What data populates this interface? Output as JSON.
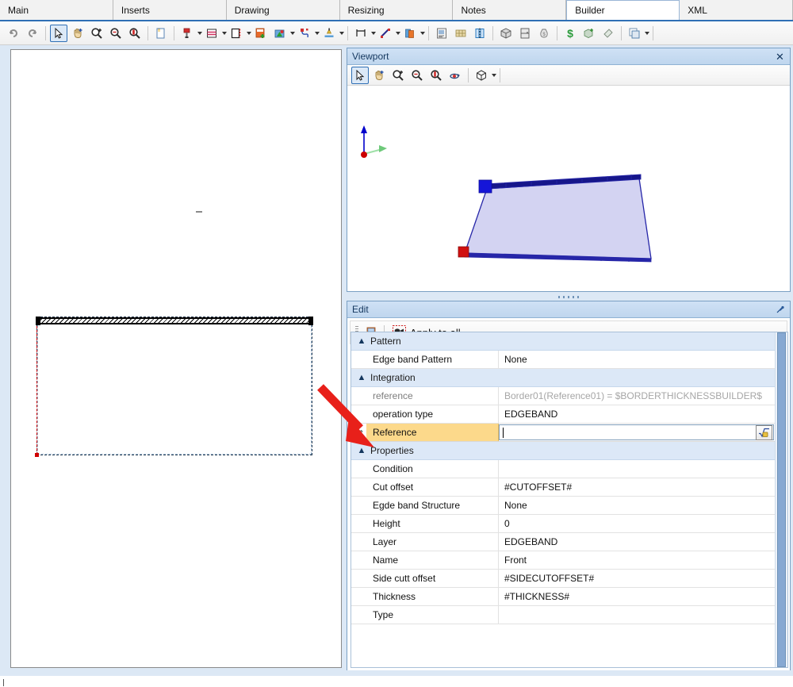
{
  "tabs": [
    {
      "label": "Main",
      "active": false
    },
    {
      "label": "Inserts",
      "active": false
    },
    {
      "label": "Drawing",
      "active": false
    },
    {
      "label": "Resizing",
      "active": false
    },
    {
      "label": "Notes",
      "active": false
    },
    {
      "label": "Builder",
      "active": true
    },
    {
      "label": "XML",
      "active": false
    }
  ],
  "toolbar": {
    "items": [
      {
        "name": "undo-icon",
        "glyph": "↶"
      },
      {
        "name": "redo-icon",
        "glyph": "↷"
      },
      {
        "name": "select-arrow-icon",
        "glyph": "➤"
      },
      {
        "name": "pan-hand-icon",
        "glyph": "✋"
      },
      {
        "name": "zoom-in-icon",
        "glyph": "🔍"
      },
      {
        "name": "zoom-out-icon",
        "glyph": "🔍"
      },
      {
        "name": "zoom-window-icon",
        "glyph": "🔍"
      },
      {
        "name": "new-panel-icon",
        "glyph": "□"
      },
      {
        "name": "drill-icon",
        "glyph": "⚒"
      },
      {
        "name": "groove-icon",
        "glyph": "☰"
      },
      {
        "name": "edgeband-icon",
        "glyph": "▯"
      },
      {
        "name": "insert-machining-icon",
        "glyph": "⊞"
      },
      {
        "name": "pocket-icon",
        "glyph": "▲"
      },
      {
        "name": "contour-icon",
        "glyph": "∿"
      },
      {
        "name": "bevel-icon",
        "glyph": "▃"
      },
      {
        "name": "dimension-icon",
        "glyph": "┐"
      },
      {
        "name": "line-icon",
        "glyph": "╱"
      },
      {
        "name": "material-icon",
        "glyph": "▣"
      },
      {
        "name": "properties-icon",
        "glyph": "▤"
      },
      {
        "name": "library-icon",
        "glyph": "▦"
      },
      {
        "name": "panel-view-icon",
        "glyph": "▮"
      },
      {
        "name": "box-3d-icon",
        "glyph": "⬛"
      },
      {
        "name": "cabinet-icon",
        "glyph": "▭"
      },
      {
        "name": "cost-bag-icon",
        "glyph": "💰"
      },
      {
        "name": "price-icon",
        "glyph": "$"
      },
      {
        "name": "export-icon",
        "glyph": "⬚"
      },
      {
        "name": "tag-icon",
        "glyph": "◇"
      },
      {
        "name": "layers-icon",
        "glyph": "❐"
      }
    ]
  },
  "viewport": {
    "title": "Viewport",
    "close_label": "✕",
    "toolbar_items": [
      {
        "name": "select-arrow-icon"
      },
      {
        "name": "pan-hand-icon"
      },
      {
        "name": "zoom-in-icon"
      },
      {
        "name": "zoom-out-icon"
      },
      {
        "name": "zoom-extents-icon"
      },
      {
        "name": "orbit-icon"
      },
      {
        "name": "view-cube-icon"
      }
    ],
    "scene": {
      "shape": "edgeband-panel-quad",
      "fill_color": "#d3d3f2",
      "outline_color": "#2626a8",
      "marker_start_color": "#1515d8",
      "marker_end_color": "#d01010",
      "axis_up_color": "#0000cc",
      "axis_right_color": "#22aa33",
      "axis_origin_color": "#cc0000"
    }
  },
  "edit": {
    "title": "Edit",
    "pin_label": "📌",
    "apply_to_all_label": "Apply to all",
    "new_item_icon": "add-item-icon",
    "apply_icon": "apply-icon"
  },
  "propgrid": {
    "sections": [
      {
        "label": "Pattern",
        "expanded": true,
        "rows": [
          {
            "name": "Edge band Pattern",
            "value": "None",
            "readonly": false,
            "selected": false
          }
        ]
      },
      {
        "label": "Integration",
        "expanded": true,
        "rows": [
          {
            "name": "reference",
            "value": "Border01(Reference01) = $BORDERTHICKNESSBUILDER$",
            "readonly": true,
            "selected": false
          },
          {
            "name": "operation type",
            "value": "EDGEBAND",
            "readonly": false,
            "selected": false
          },
          {
            "name": "Reference",
            "value": "",
            "readonly": false,
            "selected": true,
            "editing": true,
            "formula_button": "formula-editor-icon"
          }
        ]
      },
      {
        "label": "Properties",
        "expanded": true,
        "rows": [
          {
            "name": "Condition",
            "value": "",
            "readonly": false,
            "selected": false
          },
          {
            "name": "Cut offset",
            "value": "#CUTOFFSET#",
            "readonly": false,
            "selected": false
          },
          {
            "name": "Egde band Structure",
            "value": "None",
            "readonly": false,
            "selected": false
          },
          {
            "name": "Height",
            "value": "0",
            "readonly": false,
            "selected": false
          },
          {
            "name": "Layer",
            "value": "EDGEBAND",
            "readonly": false,
            "selected": false
          },
          {
            "name": "Name",
            "value": "Front",
            "readonly": false,
            "selected": false
          },
          {
            "name": "Side cutt offset",
            "value": "#SIDECUTOFFSET#",
            "readonly": false,
            "selected": false
          },
          {
            "name": "Thickness",
            "value": "#THICKNESS#",
            "readonly": false,
            "selected": false
          },
          {
            "name": "Type",
            "value": "",
            "readonly": false,
            "selected": false
          }
        ]
      }
    ]
  },
  "annotation": {
    "arrow_color": "#e8201a",
    "points_to": "Reference"
  },
  "drawing": {
    "shape": "panel-rectangle-with-top-edgeband",
    "outline_style": "dashed",
    "origin_marker_color": "#d00000"
  },
  "colors": {
    "accent": "#2f6fb5",
    "panel_bg": "#dce8f5",
    "selection": "#fcd98b",
    "category_bg": "#dce8f7"
  }
}
